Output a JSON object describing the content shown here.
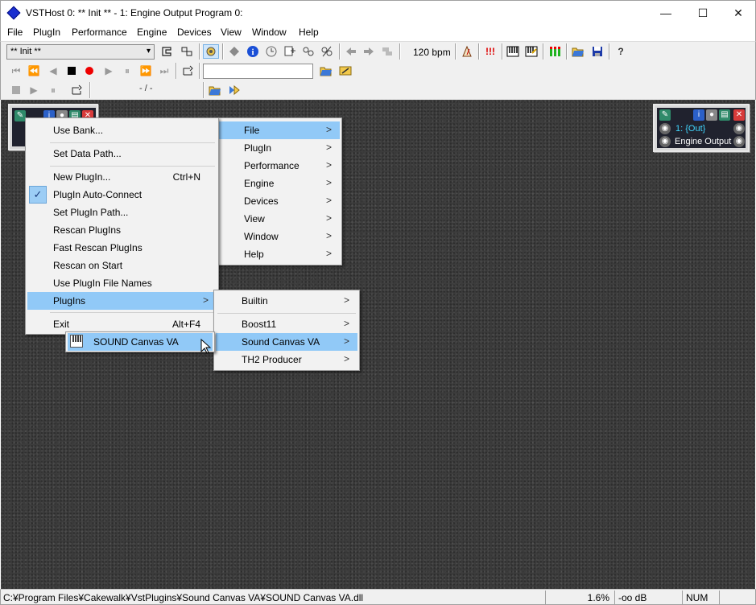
{
  "window": {
    "title": "VSTHost 0: ** Init ** - 1: Engine Output Program 0:",
    "minimize_glyph": "—",
    "maximize_glyph": "☐",
    "close_glyph": "✕"
  },
  "menubar": [
    "File",
    "PlugIn",
    "Performance",
    "Engine",
    "Devices",
    "View",
    "Window",
    "Help"
  ],
  "toolbar": {
    "program_combo": "** Init **",
    "bpm": "120 bpm",
    "position": "- / -"
  },
  "plugins": {
    "output": {
      "channel": "1: {Out}",
      "name": "Engine Output"
    }
  },
  "context_menu": {
    "items": [
      {
        "label": "Use Bank...",
        "shortcut": ""
      },
      {
        "label": "Set Data Path...",
        "shortcut": ""
      },
      {
        "label": "New PlugIn...",
        "shortcut": "Ctrl+N"
      },
      {
        "label": "PlugIn Auto-Connect",
        "shortcut": "",
        "checked": true
      },
      {
        "label": "Set PlugIn Path...",
        "shortcut": ""
      },
      {
        "label": "Rescan PlugIns",
        "shortcut": ""
      },
      {
        "label": "Fast Rescan PlugIns",
        "shortcut": ""
      },
      {
        "label": "Rescan on Start",
        "shortcut": ""
      },
      {
        "label": "Use PlugIn File Names",
        "shortcut": ""
      },
      {
        "label": "PlugIns",
        "shortcut": "",
        "submenu": true
      },
      {
        "label": "Exit",
        "shortcut": "Alt+F4"
      }
    ]
  },
  "main_menu_popup": {
    "items": [
      "File",
      "PlugIn",
      "Performance",
      "Engine",
      "Devices",
      "View",
      "Window",
      "Help"
    ]
  },
  "plugins_submenu": {
    "items": [
      "Builtin",
      "Boost11",
      "Sound Canvas VA",
      "TH2 Producer"
    ]
  },
  "sound_canvas_submenu": {
    "items": [
      "SOUND Canvas VA"
    ]
  },
  "statusbar": {
    "path": "C:¥Program Files¥Cakewalk¥VstPlugins¥Sound Canvas VA¥SOUND Canvas VA.dll",
    "cpu": "1.6%",
    "level": "-oo dB",
    "num": "NUM"
  },
  "colors": {
    "menu_highlight": "#91c9f7",
    "workspace": "#3c3c3c",
    "out_label": "#41d7ff"
  }
}
